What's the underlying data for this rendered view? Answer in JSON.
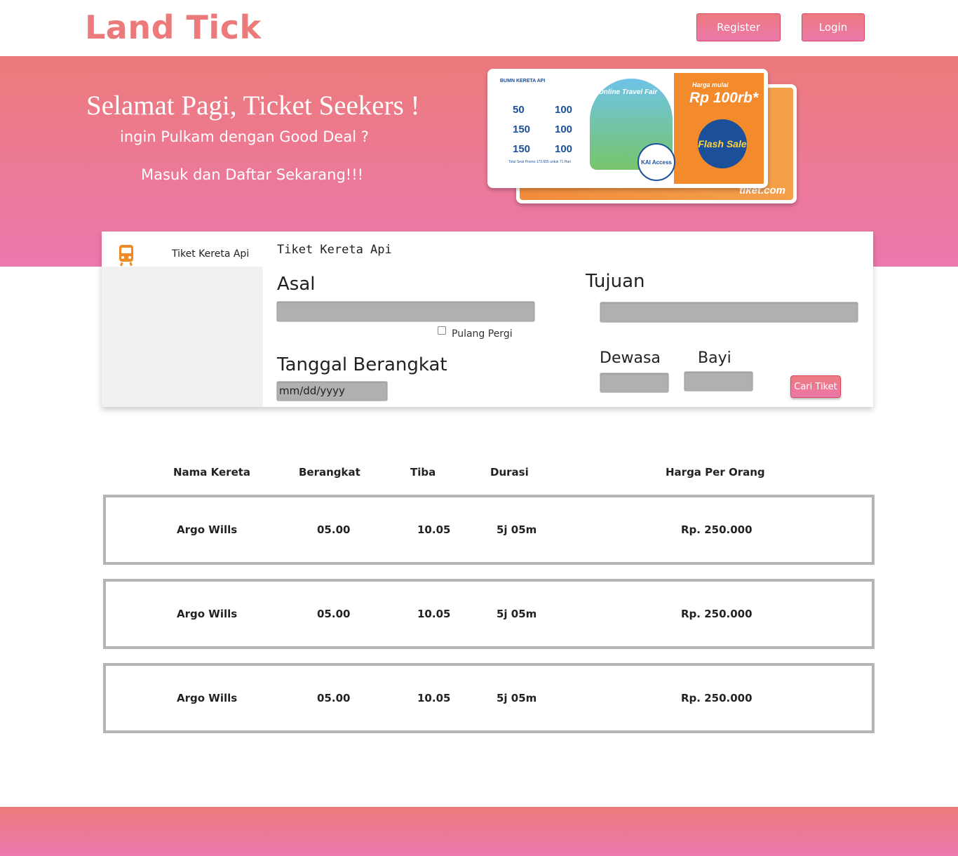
{
  "header": {
    "logo": "Land Tick",
    "register_label": "Register",
    "login_label": "Login",
    "accent_color": "#ec7a7a"
  },
  "hero": {
    "title": "Selamat Pagi, Ticket Seekers !",
    "subtitle": "ingin Pulkam dengan Good Deal ?",
    "cta_text": "Masuk dan Daftar Sekarang!!!",
    "banner": {
      "logos_text": "BUMN   KERETA API",
      "event_label": "Online Travel Fair",
      "prices": [
        "50",
        "100",
        "150",
        "100",
        "150",
        "100"
      ],
      "promo_text": "Total Seat Promo 173.655 untuk 71 Hari",
      "harga_mulai": "Harga mulai",
      "harga_value": "Rp 100rb*",
      "flash_sale": "Flash Sale",
      "kai_label": "KAI Access",
      "back_brand": "tiket.com"
    }
  },
  "search": {
    "side_tab_label": "Tiket Kereta Api",
    "side_tab_icon": "train-icon",
    "title": "Tiket Kereta Api",
    "asal_label": "Asal",
    "tujuan_label": "Tujuan",
    "pulang_pergi_label": "Pulang Pergi",
    "tanggal_label": "Tanggal Berangkat",
    "tanggal_placeholder": "mm/dd/yyyy",
    "dewasa_label": "Dewasa",
    "bayi_label": "Bayi",
    "search_button_label": "Cari Tiket"
  },
  "results": {
    "headers": [
      "Nama Kereta",
      "Berangkat",
      "Tiba",
      "Durasi",
      "Harga Per Orang"
    ],
    "rows": [
      [
        "Argo Wills",
        "05.00",
        "10.05",
        "5j 05m",
        "Rp. 250.000"
      ],
      [
        "Argo Wills",
        "05.00",
        "10.05",
        "5j 05m",
        "Rp. 250.000"
      ],
      [
        "Argo Wills",
        "05.00",
        "10.05",
        "5j 05m",
        "Rp. 250.000"
      ]
    ]
  }
}
